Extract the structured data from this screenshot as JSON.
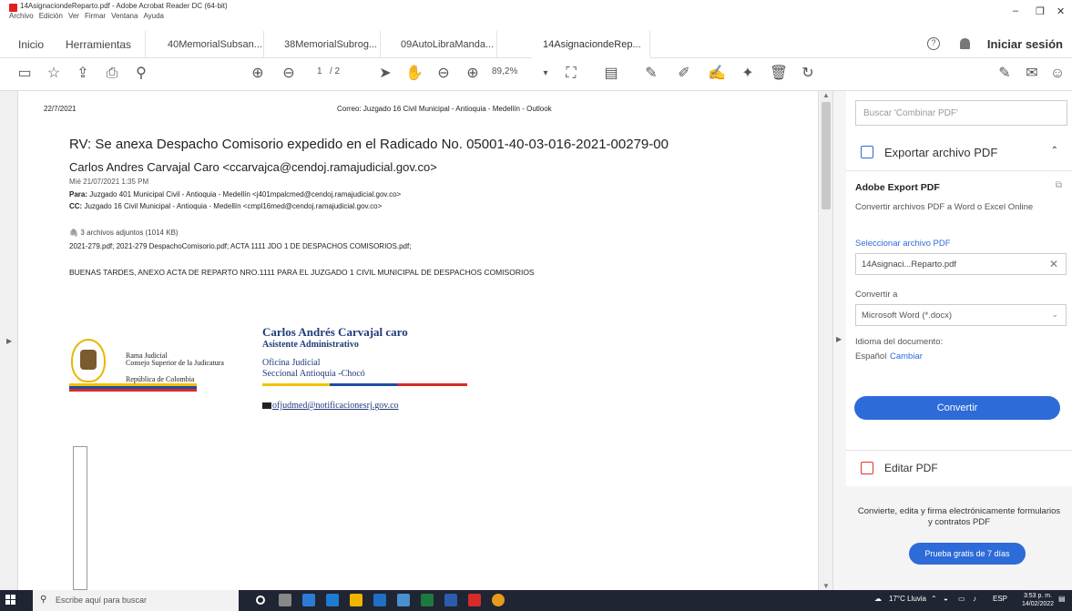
{
  "window": {
    "title": "14AsignaciondeReparto.pdf - Adobe Acrobat Reader DC (64-bit)",
    "menu": [
      "Archivo",
      "Edición",
      "Ver",
      "Firmar",
      "Ventana",
      "Ayuda"
    ],
    "controls": {
      "minimize": "–",
      "restore": "❐",
      "close": "✕"
    }
  },
  "tabs": {
    "home": "Inicio",
    "tools": "Herramientas",
    "docs": [
      "40MemorialSubsan...",
      "38MemorialSubrog...",
      "09AutoLibraManda...",
      "14AsignaciondeRep..."
    ],
    "close_glyph": "×",
    "login": "Iniciar sesión"
  },
  "toolbar": {
    "page_current": "1",
    "page_total": "/ 2",
    "zoom": "89,2%"
  },
  "document": {
    "header_date": "22/7/2021",
    "header_mail": "Correo: Juzgado 16 Civil Municipal - Antioquia - Medellín - Outlook",
    "subject": "RV: Se anexa Despacho Comisorio expedido en el Radicado No. 05001-40-03-016-2021-00279-00",
    "sender": "Carlos Andres Carvajal Caro <ccarvajca@cendoj.ramajudicial.gov.co>",
    "sent_date": "Mié 21/07/2021 1:35 PM",
    "to_label": "Para:",
    "to_value": "Juzgado 401 Municipal Civil - Antioquia - Medellín <j401mpalcmed@cendoj.ramajudicial.gov.co>",
    "cc_label": "CC:",
    "cc_value": "Juzgado 16 Civil Municipal - Antioquia - Medellín <cmpl16med@cendoj.ramajudicial.gov.co>",
    "attachments_count": "3 archivos adjuntos (1014 KB)",
    "attachments_list": "2021-279.pdf; 2021-279 DespachoComisorio.pdf; ACTA 1111 JDO 1 DE DESPACHOS COMISORIOS.pdf;",
    "body": "BUENAS TARDES, ANEXO ACTA DE REPARTO NRO.1111 PARA EL JUZGADO 1  CIVIL MUNICIPAL DE DESPACHOS COMISORIOS",
    "logo_line1": "Rama Judicial",
    "logo_line2": "Consejo Superior de la Judicatura",
    "logo_line3": "República de Colombia",
    "sig_name": "Carlos Andrés Carvajal caro",
    "sig_role": "Asistente Administrativo",
    "sig_office1": "Oficina Judicial",
    "sig_office2": "Seccional Antioquia -Chocó",
    "sig_mail": "ofjudmed@notificacionesrj.gov.co"
  },
  "right_panel": {
    "search_placeholder": "Buscar 'Combinar PDF'",
    "export_header": "Exportar archivo PDF",
    "aep_title": "Adobe Export PDF",
    "aep_desc": "Convertir archivos PDF a Word o Excel Online",
    "select_label": "Seleccionar archivo PDF",
    "file_name": "14Asignaci...Reparto.pdf",
    "convert_to_label": "Convertir a",
    "convert_to_value": "Microsoft Word (*.docx)",
    "lang_label": "Idioma del documento:",
    "lang_value": "Español",
    "lang_change": "Cambiar",
    "convert_button": "Convertir",
    "edit_header": "Editar PDF",
    "promo_text": "Convierte, edita y firma electrónicamente formularios y contratos PDF",
    "promo_button": "Prueba gratis de 7 días"
  },
  "taskbar": {
    "search_text": "Escribe aquí para buscar",
    "weather": "17°C Lluvia",
    "lang": "ESP",
    "time": "3:53 p. m.",
    "date": "14/02/2022"
  }
}
